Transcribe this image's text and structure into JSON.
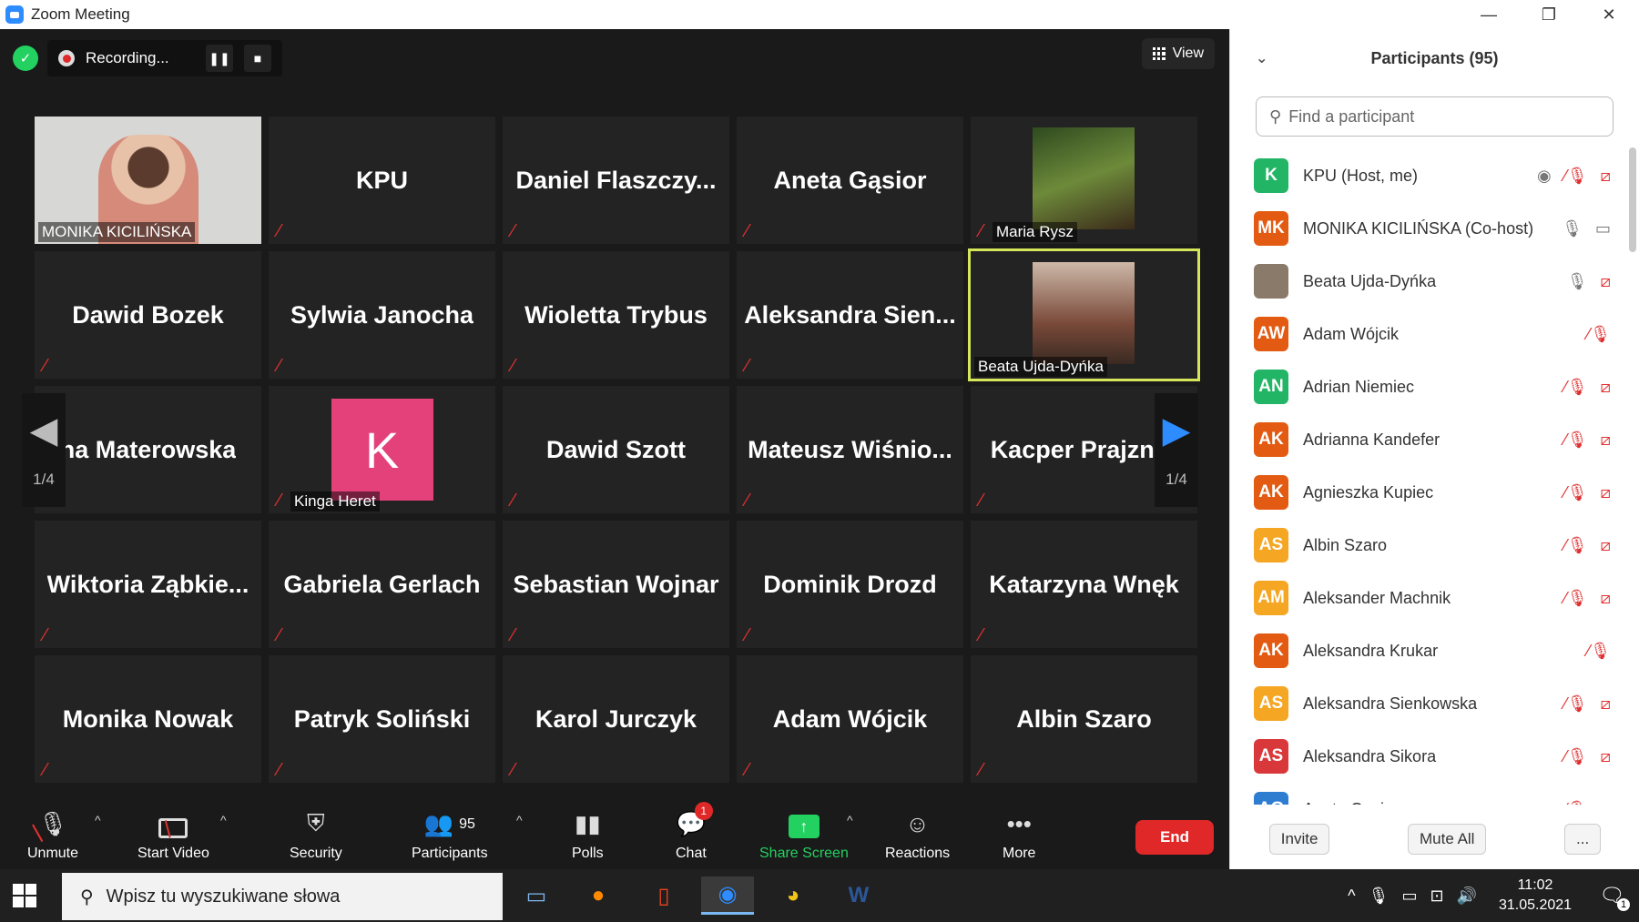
{
  "window": {
    "title": "Zoom Meeting",
    "minimize": "—",
    "restore": "❐",
    "close": "✕"
  },
  "recording": {
    "label": "Recording...",
    "pause": "❚❚",
    "stop": "■"
  },
  "view": {
    "label": "View"
  },
  "tiles": [
    {
      "name": "",
      "label": "MONIKA KICILIŃSKA",
      "kind": "video"
    },
    {
      "name": "KPU",
      "label": "",
      "kind": "name"
    },
    {
      "name": "Daniel  Flaszczy...",
      "label": "",
      "kind": "name"
    },
    {
      "name": "Aneta Gąsior",
      "label": "",
      "kind": "name"
    },
    {
      "name": "",
      "label": "Maria Rysz",
      "kind": "photo"
    },
    {
      "name": "Dawid Bozek",
      "label": "",
      "kind": "name"
    },
    {
      "name": "Sylwia Janocha",
      "label": "",
      "kind": "name"
    },
    {
      "name": "Wioletta Trybus",
      "label": "",
      "kind": "name"
    },
    {
      "name": "Aleksandra  Sien...",
      "label": "",
      "kind": "name"
    },
    {
      "name": "",
      "label": "Beata Ujda-Dyńka",
      "kind": "photo-active"
    },
    {
      "name": "na Materowska",
      "label": "",
      "kind": "name"
    },
    {
      "name": "K",
      "label": "Kinga Heret",
      "kind": "avatar"
    },
    {
      "name": "Dawid Szott",
      "label": "",
      "kind": "name"
    },
    {
      "name": "Mateusz  Wiśnio...",
      "label": "",
      "kind": "name"
    },
    {
      "name": "Kacper Prajzner",
      "label": "",
      "kind": "name"
    },
    {
      "name": "Wiktoria  Ząbkie...",
      "label": "",
      "kind": "name"
    },
    {
      "name": "Gabriela Gerlach",
      "label": "",
      "kind": "name"
    },
    {
      "name": "Sebastian Wojnar",
      "label": "",
      "kind": "name"
    },
    {
      "name": "Dominik Drozd",
      "label": "",
      "kind": "name"
    },
    {
      "name": "Katarzyna Wnęk",
      "label": "",
      "kind": "name"
    },
    {
      "name": "Monika Nowak",
      "label": "",
      "kind": "name"
    },
    {
      "name": "Patryk Soliński",
      "label": "",
      "kind": "name"
    },
    {
      "name": "Karol Jurczyk",
      "label": "",
      "kind": "name"
    },
    {
      "name": "Adam Wójcik",
      "label": "",
      "kind": "name"
    },
    {
      "name": "Albin Szaro",
      "label": "",
      "kind": "name"
    }
  ],
  "pager": {
    "left": "1/4",
    "right": "1/4"
  },
  "toolbar": {
    "unmute": "Unmute",
    "start_video": "Start Video",
    "security": "Security",
    "participants": "Participants",
    "participants_count": "95",
    "polls": "Polls",
    "chat": "Chat",
    "chat_badge": "1",
    "share_screen": "Share Screen",
    "reactions": "Reactions",
    "more": "More",
    "end": "End"
  },
  "panel": {
    "title": "Participants (95)",
    "search_placeholder": "Find a participant",
    "participants": [
      {
        "initials": "K",
        "name": "KPU (Host, me)",
        "color": "#23b566",
        "icons": [
          "record",
          "mic-off",
          "video-off"
        ]
      },
      {
        "initials": "MK",
        "name": "MONIKA KICILIŃSKA (Co-host)",
        "color": "#e35b12",
        "icons": [
          "mic-on",
          "video-on"
        ]
      },
      {
        "initials": "",
        "name": "Beata Ujda-Dyńka",
        "color": "#8a7a6a",
        "icons": [
          "mic-on",
          "video-off"
        ]
      },
      {
        "initials": "AW",
        "name": "Adam Wójcik",
        "color": "#e35b12",
        "icons": [
          "mic-off"
        ]
      },
      {
        "initials": "AN",
        "name": "Adrian Niemiec",
        "color": "#23b566",
        "icons": [
          "mic-off",
          "video-off"
        ]
      },
      {
        "initials": "AK",
        "name": "Adrianna Kandefer",
        "color": "#e35b12",
        "icons": [
          "mic-off",
          "video-off"
        ]
      },
      {
        "initials": "AK",
        "name": "Agnieszka Kupiec",
        "color": "#e35b12",
        "icons": [
          "mic-off",
          "video-off"
        ]
      },
      {
        "initials": "AS",
        "name": "Albin Szaro",
        "color": "#f5a623",
        "icons": [
          "mic-off",
          "video-off"
        ]
      },
      {
        "initials": "AM",
        "name": "Aleksander Machnik",
        "color": "#f5a623",
        "icons": [
          "mic-off",
          "video-off"
        ]
      },
      {
        "initials": "AK",
        "name": "Aleksandra Krukar",
        "color": "#e35b12",
        "icons": [
          "mic-off"
        ]
      },
      {
        "initials": "AS",
        "name": "Aleksandra Sienkowska",
        "color": "#f5a623",
        "icons": [
          "mic-off",
          "video-off"
        ]
      },
      {
        "initials": "AS",
        "name": "Aleksandra Sikora",
        "color": "#d9383a",
        "icons": [
          "mic-off",
          "video-off"
        ]
      },
      {
        "initials": "AG",
        "name": "Aneta Gąsior",
        "color": "#2f7dd1",
        "icons": [
          "mic-off",
          "video-off"
        ]
      }
    ],
    "invite": "Invite",
    "mute_all": "Mute All",
    "more": "..."
  },
  "taskbar": {
    "search_placeholder": "Wpisz tu wyszukiwane słowa",
    "time": "11:02",
    "date": "31.05.2021",
    "notifications": "1"
  }
}
